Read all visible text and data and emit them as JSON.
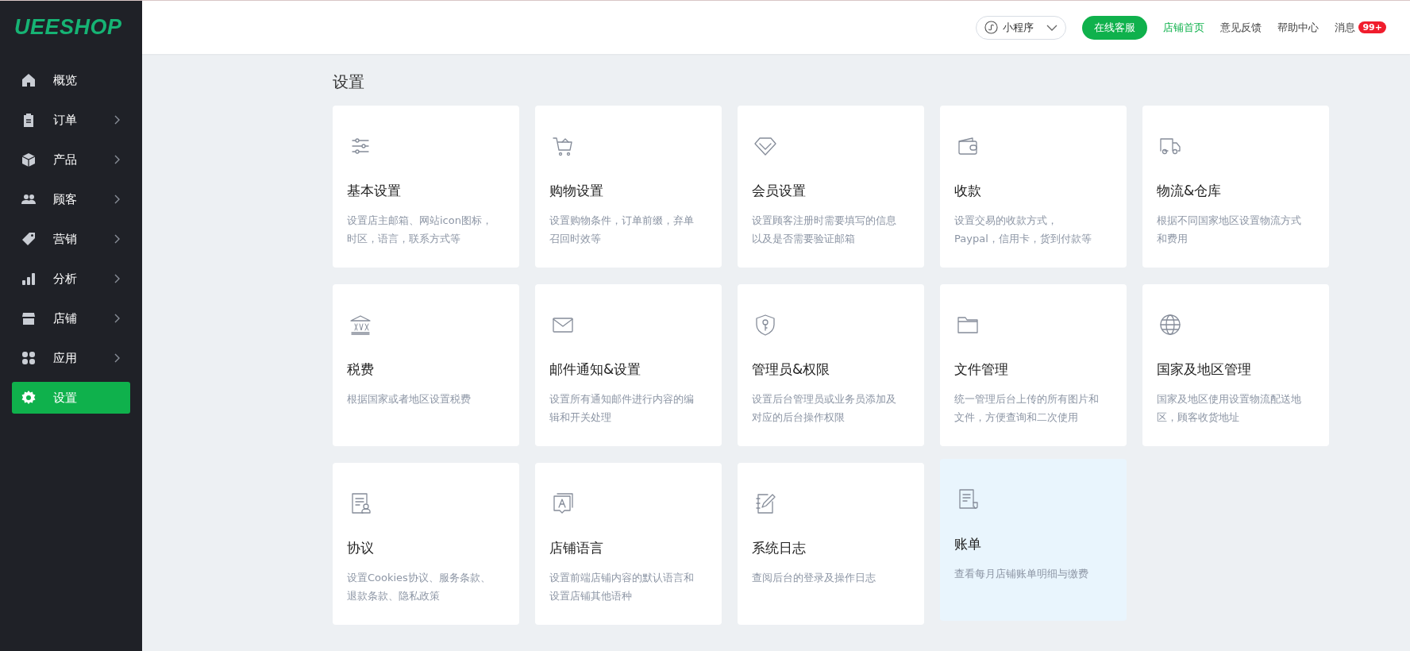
{
  "logo": "UEESHOP",
  "sidebar": {
    "items": [
      {
        "label": "概览",
        "kind": "home",
        "has_submenu": false,
        "selected": false
      },
      {
        "label": "订单",
        "kind": "clipboard",
        "has_submenu": true,
        "selected": false
      },
      {
        "label": "产品",
        "kind": "box",
        "has_submenu": true,
        "selected": false
      },
      {
        "label": "顾客",
        "kind": "users",
        "has_submenu": true,
        "selected": false
      },
      {
        "label": "营销",
        "kind": "tag",
        "has_submenu": true,
        "selected": false
      },
      {
        "label": "分析",
        "kind": "bars",
        "has_submenu": true,
        "selected": false
      },
      {
        "label": "店铺",
        "kind": "store",
        "has_submenu": true,
        "selected": false
      },
      {
        "label": "应用",
        "kind": "apps",
        "has_submenu": true,
        "selected": false
      },
      {
        "label": "设置",
        "kind": "gear",
        "has_submenu": false,
        "selected": true
      }
    ]
  },
  "topbar": {
    "mini_program": "小程序",
    "support_button": "在线客服",
    "links": [
      {
        "label": "店铺首页",
        "selected": true
      },
      {
        "label": "意见反馈",
        "selected": false
      },
      {
        "label": "帮助中心",
        "selected": false
      }
    ],
    "messages": {
      "label": "消息",
      "badge": "99+"
    }
  },
  "page_title": "设置",
  "cards": [
    {
      "kind": "sliders",
      "title": "基本设置",
      "description": "设置店主邮箱、网站icon图标，时区，语言，联系方式等",
      "hovered": false
    },
    {
      "kind": "cart",
      "title": "购物设置",
      "description": "设置购物条件，订单前缀，弃单召回时效等",
      "hovered": false
    },
    {
      "kind": "diamond",
      "title": "会员设置",
      "description": "设置顾客注册时需要填写的信息以及是否需要验证邮箱",
      "hovered": false
    },
    {
      "kind": "wallet",
      "title": "收款",
      "description": "设置交易的收款方式，\nPaypal，信用卡，货到付款等",
      "hovered": false
    },
    {
      "kind": "truck",
      "title": "物流&仓库",
      "description": "根据不同国家地区设置物流方式和费用",
      "hovered": false
    },
    {
      "kind": "tax",
      "title": "税费",
      "description": "根据国家或者地区设置税费",
      "hovered": false
    },
    {
      "kind": "mail",
      "title": "邮件通知&设置",
      "description": "设置所有通知邮件进行内容的编辑和开关处理",
      "hovered": false
    },
    {
      "kind": "shield",
      "title": "管理员&权限",
      "description": "设置后台管理员或业务员添加及对应的后台操作权限",
      "hovered": false
    },
    {
      "kind": "folder",
      "title": "文件管理",
      "description": "统一管理后台上传的所有图片和文件，方便查询和二次使用",
      "hovered": false
    },
    {
      "kind": "globe",
      "title": "国家及地区管理",
      "description": "国家及地区使用设置物流配送地区，顾客收货地址",
      "hovered": false
    },
    {
      "kind": "contract",
      "title": "协议",
      "description": "设置Cookies协议、服务条款、退款条款、隐私政策",
      "hovered": false
    },
    {
      "kind": "language",
      "title": "店铺语言",
      "description": "设置前端店铺内容的默认语言和设置店铺其他语种",
      "hovered": false
    },
    {
      "kind": "log",
      "title": "系统日志",
      "description": "查阅后台的登录及操作日志",
      "hovered": false
    },
    {
      "kind": "bill",
      "title": "账单",
      "description": "查看每月店铺账单明细与缴费",
      "hovered": true
    }
  ]
}
